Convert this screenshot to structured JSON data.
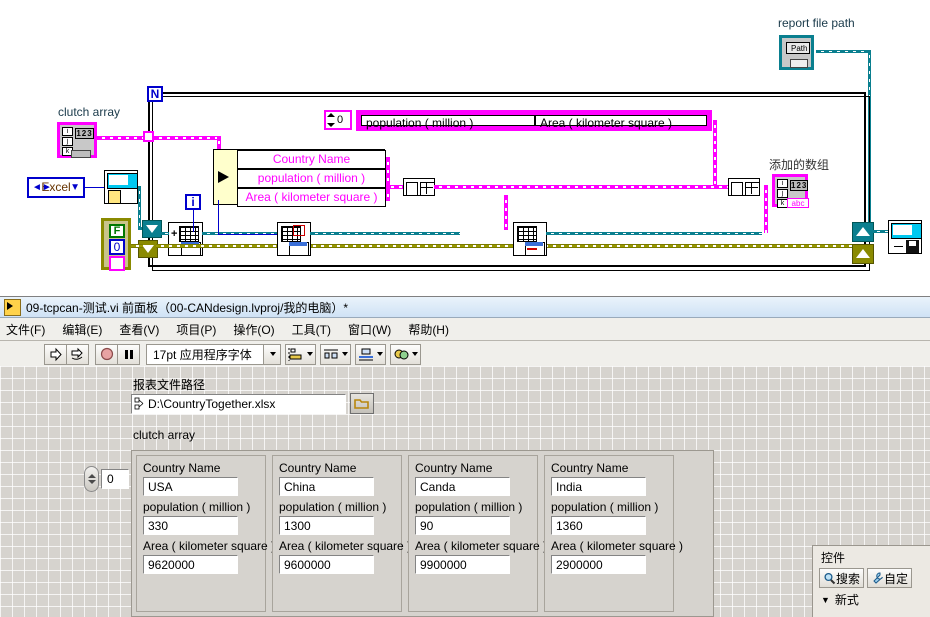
{
  "diagram": {
    "labels": {
      "clutch_array": "clutch array",
      "report_file_path": "report file path",
      "added_array": "添加的数组"
    },
    "enum_value": "Excel",
    "string_array_index": "0",
    "string_array_cells": [
      "population ( million )",
      "Area ( kilometer square )"
    ],
    "unbundle_rows": [
      "Country Name",
      "population ( million )",
      "Area ( kilometer square )"
    ],
    "loop_count_terminal": "N",
    "loop_iteration_terminal": "i",
    "array_index_letters": [
      "i",
      "j",
      "k"
    ],
    "numeric_glyph": "123",
    "string_glyph": "abc",
    "path_glyph": "Path",
    "cluster_constant": {
      "boolean": "F",
      "numeric": "0",
      "string": ""
    }
  },
  "window": {
    "title": "09-tcpcan-测试.vi 前面板（00-CANdesign.lvproj/我的电脑）*",
    "menu": [
      "文件(F)",
      "编辑(E)",
      "查看(V)",
      "项目(P)",
      "操作(O)",
      "工具(T)",
      "窗口(W)",
      "帮助(H)"
    ],
    "toolbar": {
      "run": "run-arrow",
      "run_continuously": "run-continuously",
      "abort": "abort-execution",
      "pause": "pause",
      "font": "17pt 应用程序字体",
      "align": "align-objects",
      "distribute": "distribute-objects",
      "resize": "resize-objects",
      "reorder": "reorder-objects"
    }
  },
  "panel": {
    "path_label": "报表文件路径",
    "path_value": "D:\\CountryTogether.xlsx",
    "browse_icon": "folder-icon",
    "array_label": "clutch array",
    "array_index": "0",
    "cluster_field_labels": [
      "Country Name",
      "population ( million )",
      "Area ( kilometer square )"
    ],
    "clusters": [
      {
        "country": "USA",
        "population": "330",
        "area": "9620000"
      },
      {
        "country": "China",
        "population": "1300",
        "area": "9600000"
      },
      {
        "country": "Canda",
        "population": "90",
        "area": "9900000"
      },
      {
        "country": "India",
        "population": "1360",
        "area": "2900000"
      }
    ]
  },
  "palette": {
    "title": "控件",
    "search": "搜索",
    "customize": "自定",
    "category": "新式"
  },
  "colors": {
    "wire_cluster": "#0a7f8f",
    "wire_string": "#ff00ff",
    "wire_numeric": "#0000cc",
    "wire_error": "#8a8a00",
    "panel_bg": "#d6d3ce"
  }
}
